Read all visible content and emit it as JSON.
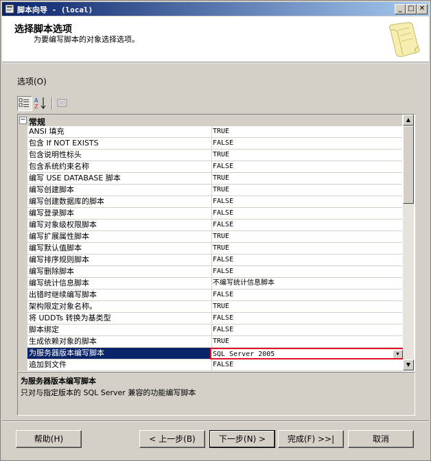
{
  "window": {
    "title": "脚本向导 - (local)",
    "min_glyph": "_",
    "max_glyph": "□",
    "close_glyph": "✕"
  },
  "header": {
    "title": "选择脚本选项",
    "subtitle": "为要编写脚本的对象选择选项。"
  },
  "options_label": "选项(O)",
  "grid": {
    "category": "常规",
    "expander": "⊟",
    "rows": [
      {
        "name": "ANSI 填充",
        "value": "TRUE"
      },
      {
        "name": "包含 If NOT EXISTS",
        "value": "FALSE"
      },
      {
        "name": "包含说明性标头",
        "value": "TRUE"
      },
      {
        "name": "包含系统约束名称",
        "value": "FALSE"
      },
      {
        "name": "编写 USE DATABASE 脚本",
        "value": "TRUE"
      },
      {
        "name": "编写创建脚本",
        "value": "TRUE"
      },
      {
        "name": "编写创建数据库的脚本",
        "value": "FALSE"
      },
      {
        "name": "编写登录脚本",
        "value": "FALSE"
      },
      {
        "name": "编写对象级权限脚本",
        "value": "FALSE"
      },
      {
        "name": "编写扩展属性脚本",
        "value": "TRUE"
      },
      {
        "name": "编写默认值脚本",
        "value": "TRUE"
      },
      {
        "name": "编写排序规则脚本",
        "value": "FALSE"
      },
      {
        "name": "编写删除脚本",
        "value": "FALSE"
      },
      {
        "name": "编写统计信息脚本",
        "value": "不编写统计信息脚本"
      },
      {
        "name": "出错时继续编写脚本",
        "value": "FALSE"
      },
      {
        "name": "架构限定对象名称。",
        "value": "TRUE"
      },
      {
        "name": "将 UDDTs 转换为基类型",
        "value": "FALSE"
      },
      {
        "name": "脚本绑定",
        "value": "FALSE"
      },
      {
        "name": "生成依赖对象的脚本",
        "value": "TRUE"
      },
      {
        "name": "为服务器版本编写脚本",
        "value": "SQL Server 2005"
      },
      {
        "name": "追加到文件",
        "value": "FALSE"
      }
    ],
    "selected_index": 19
  },
  "description": {
    "title": "为服务器版本编写脚本",
    "text": "只对与指定版本的 SQL Server 兼容的功能编写脚本"
  },
  "buttons": {
    "help": "帮助(H)",
    "back": "< 上一步(B)",
    "next": "下一步(N) >",
    "finish": "完成(F) >>|",
    "cancel": "取消"
  },
  "scroll": {
    "up": "▲",
    "down": "▼"
  },
  "colors": {
    "selection": "#0a246a",
    "highlight_border": "#e0102a"
  }
}
